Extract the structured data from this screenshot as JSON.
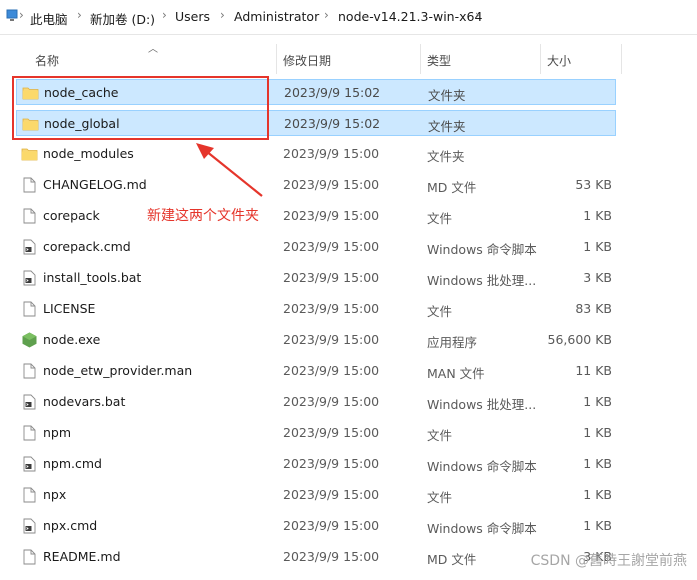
{
  "breadcrumb": [
    {
      "label": "此电脑"
    },
    {
      "label": "新加卷 (D:)"
    },
    {
      "label": "Users"
    },
    {
      "label": "Administrator"
    },
    {
      "label": "node-v14.21.3-win-x64"
    }
  ],
  "columns": {
    "name": "名称",
    "modified": "修改日期",
    "type": "类型",
    "size": "大小"
  },
  "rows": [
    {
      "name": "node_cache",
      "date": "2023/9/9 15:02",
      "type": "文件夹",
      "size": "",
      "icon": "folder-icon",
      "selected": true
    },
    {
      "name": "node_global",
      "date": "2023/9/9 15:02",
      "type": "文件夹",
      "size": "",
      "icon": "folder-icon",
      "selected": true
    },
    {
      "name": "node_modules",
      "date": "2023/9/9 15:00",
      "type": "文件夹",
      "size": "",
      "icon": "folder-icon"
    },
    {
      "name": "CHANGELOG.md",
      "date": "2023/9/9 15:00",
      "type": "MD 文件",
      "size": "53 KB",
      "icon": "file-icon"
    },
    {
      "name": "corepack",
      "date": "2023/9/9 15:00",
      "type": "文件",
      "size": "1 KB",
      "icon": "file-icon"
    },
    {
      "name": "corepack.cmd",
      "date": "2023/9/9 15:00",
      "type": "Windows 命令脚本",
      "size": "1 KB",
      "icon": "script-icon"
    },
    {
      "name": "install_tools.bat",
      "date": "2023/9/9 15:00",
      "type": "Windows 批处理...",
      "size": "3 KB",
      "icon": "script-icon"
    },
    {
      "name": "LICENSE",
      "date": "2023/9/9 15:00",
      "type": "文件",
      "size": "83 KB",
      "icon": "file-icon"
    },
    {
      "name": "node.exe",
      "date": "2023/9/9 15:00",
      "type": "应用程序",
      "size": "56,600 KB",
      "icon": "nodejs-icon"
    },
    {
      "name": "node_etw_provider.man",
      "date": "2023/9/9 15:00",
      "type": "MAN 文件",
      "size": "11 KB",
      "icon": "file-icon"
    },
    {
      "name": "nodevars.bat",
      "date": "2023/9/9 15:00",
      "type": "Windows 批处理...",
      "size": "1 KB",
      "icon": "script-icon"
    },
    {
      "name": "npm",
      "date": "2023/9/9 15:00",
      "type": "文件",
      "size": "1 KB",
      "icon": "file-icon"
    },
    {
      "name": "npm.cmd",
      "date": "2023/9/9 15:00",
      "type": "Windows 命令脚本",
      "size": "1 KB",
      "icon": "script-icon"
    },
    {
      "name": "npx",
      "date": "2023/9/9 15:00",
      "type": "文件",
      "size": "1 KB",
      "icon": "file-icon"
    },
    {
      "name": "npx.cmd",
      "date": "2023/9/9 15:00",
      "type": "Windows 命令脚本",
      "size": "1 KB",
      "icon": "script-icon"
    },
    {
      "name": "README.md",
      "date": "2023/9/9 15:00",
      "type": "MD 文件",
      "size": "3 KB",
      "icon": "file-icon"
    }
  ],
  "annotation": "新建这两个文件夹",
  "watermark": "CSDN @舊時王謝堂前燕",
  "colors": {
    "selection": "#cce8ff",
    "selection_border": "#99d1ff",
    "annotation_red": "#e5352b",
    "folder": "#f8d775"
  }
}
